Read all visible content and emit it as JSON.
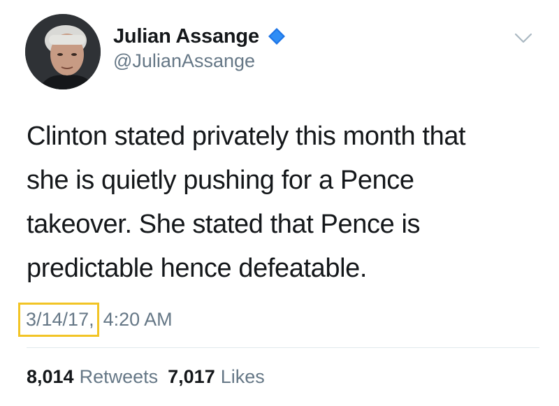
{
  "user": {
    "display_name": "Julian Assange",
    "handle": "@JulianAssange",
    "verified": true
  },
  "tweet": {
    "text": "Clinton stated privately this month that\nshe is quietly pushing for a Pence\ntakeover. She stated that Pence is\npredictable hence defeatable.",
    "date": "3/14/17,",
    "time": "4:20 AM"
  },
  "stats": {
    "retweets_count": "8,014",
    "retweets_label": "Retweets",
    "likes_count": "7,017",
    "likes_label": "Likes"
  },
  "icons": {
    "verified": "verified-badge-icon",
    "menu": "chevron-down-icon"
  },
  "colors": {
    "verified_blue": "#1da1f2",
    "highlight_box": "#f2c425",
    "secondary_text": "#657786"
  }
}
